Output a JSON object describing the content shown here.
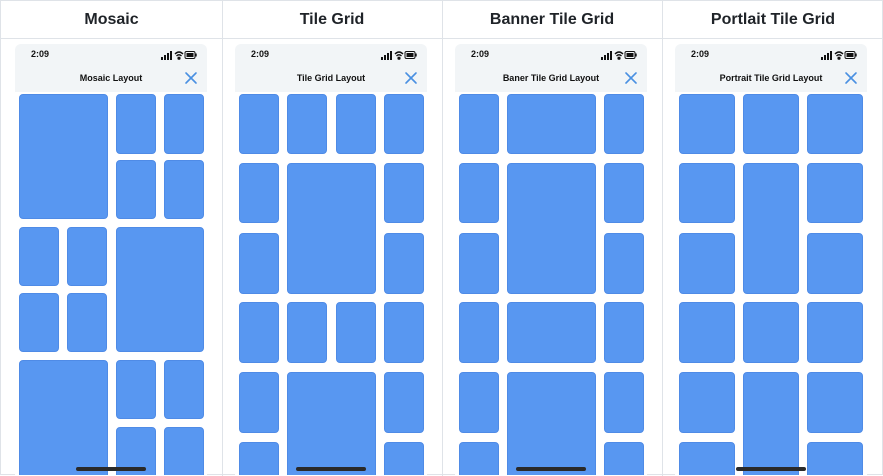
{
  "columns": [
    {
      "title": "Mosaic",
      "time": "2:09",
      "nav_title": "Mosaic Layout"
    },
    {
      "title": "Tile Grid",
      "time": "2:09",
      "nav_title": "Tile Grid Layout"
    },
    {
      "title": "Banner Tile Grid",
      "time": "2:09",
      "nav_title": "Baner Tile Grid Layout"
    },
    {
      "title": "Portlait Tile Grid",
      "time": "2:09",
      "nav_title": "Portrait Tile Grid Layout"
    }
  ],
  "icons": {
    "signal": "cellular-signal-icon",
    "wifi": "wifi-icon",
    "battery": "battery-icon",
    "close": "close-icon"
  },
  "colors": {
    "tile": "#5897f1",
    "accent": "#4a90e2"
  }
}
